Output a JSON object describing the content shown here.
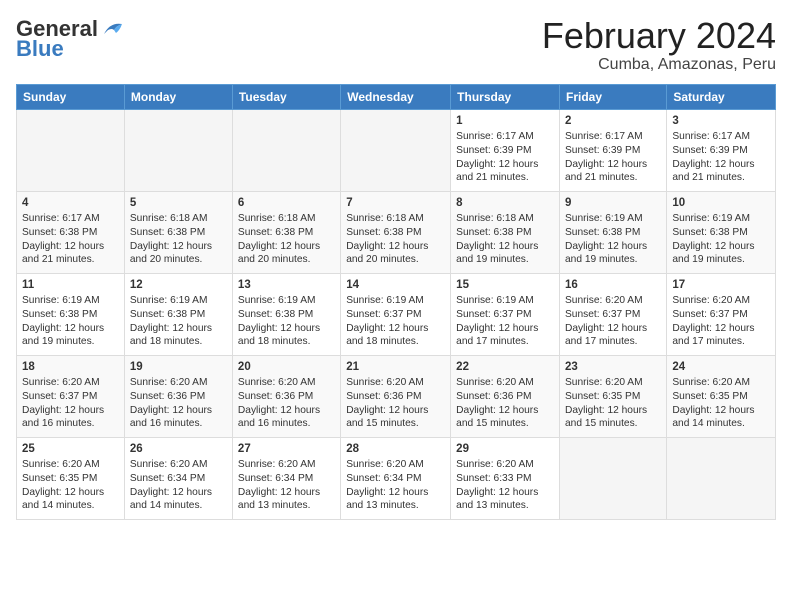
{
  "header": {
    "logo_general": "General",
    "logo_blue": "Blue",
    "title": "February 2024",
    "subtitle": "Cumba, Amazonas, Peru"
  },
  "days_of_week": [
    "Sunday",
    "Monday",
    "Tuesday",
    "Wednesday",
    "Thursday",
    "Friday",
    "Saturday"
  ],
  "weeks": [
    [
      {
        "day": "",
        "info": ""
      },
      {
        "day": "",
        "info": ""
      },
      {
        "day": "",
        "info": ""
      },
      {
        "day": "",
        "info": ""
      },
      {
        "day": "1",
        "info": "Sunrise: 6:17 AM\nSunset: 6:39 PM\nDaylight: 12 hours and 21 minutes."
      },
      {
        "day": "2",
        "info": "Sunrise: 6:17 AM\nSunset: 6:39 PM\nDaylight: 12 hours and 21 minutes."
      },
      {
        "day": "3",
        "info": "Sunrise: 6:17 AM\nSunset: 6:39 PM\nDaylight: 12 hours and 21 minutes."
      }
    ],
    [
      {
        "day": "4",
        "info": "Sunrise: 6:17 AM\nSunset: 6:38 PM\nDaylight: 12 hours and 21 minutes."
      },
      {
        "day": "5",
        "info": "Sunrise: 6:18 AM\nSunset: 6:38 PM\nDaylight: 12 hours and 20 minutes."
      },
      {
        "day": "6",
        "info": "Sunrise: 6:18 AM\nSunset: 6:38 PM\nDaylight: 12 hours and 20 minutes."
      },
      {
        "day": "7",
        "info": "Sunrise: 6:18 AM\nSunset: 6:38 PM\nDaylight: 12 hours and 20 minutes."
      },
      {
        "day": "8",
        "info": "Sunrise: 6:18 AM\nSunset: 6:38 PM\nDaylight: 12 hours and 19 minutes."
      },
      {
        "day": "9",
        "info": "Sunrise: 6:19 AM\nSunset: 6:38 PM\nDaylight: 12 hours and 19 minutes."
      },
      {
        "day": "10",
        "info": "Sunrise: 6:19 AM\nSunset: 6:38 PM\nDaylight: 12 hours and 19 minutes."
      }
    ],
    [
      {
        "day": "11",
        "info": "Sunrise: 6:19 AM\nSunset: 6:38 PM\nDaylight: 12 hours and 19 minutes."
      },
      {
        "day": "12",
        "info": "Sunrise: 6:19 AM\nSunset: 6:38 PM\nDaylight: 12 hours and 18 minutes."
      },
      {
        "day": "13",
        "info": "Sunrise: 6:19 AM\nSunset: 6:38 PM\nDaylight: 12 hours and 18 minutes."
      },
      {
        "day": "14",
        "info": "Sunrise: 6:19 AM\nSunset: 6:37 PM\nDaylight: 12 hours and 18 minutes."
      },
      {
        "day": "15",
        "info": "Sunrise: 6:19 AM\nSunset: 6:37 PM\nDaylight: 12 hours and 17 minutes."
      },
      {
        "day": "16",
        "info": "Sunrise: 6:20 AM\nSunset: 6:37 PM\nDaylight: 12 hours and 17 minutes."
      },
      {
        "day": "17",
        "info": "Sunrise: 6:20 AM\nSunset: 6:37 PM\nDaylight: 12 hours and 17 minutes."
      }
    ],
    [
      {
        "day": "18",
        "info": "Sunrise: 6:20 AM\nSunset: 6:37 PM\nDaylight: 12 hours and 16 minutes."
      },
      {
        "day": "19",
        "info": "Sunrise: 6:20 AM\nSunset: 6:36 PM\nDaylight: 12 hours and 16 minutes."
      },
      {
        "day": "20",
        "info": "Sunrise: 6:20 AM\nSunset: 6:36 PM\nDaylight: 12 hours and 16 minutes."
      },
      {
        "day": "21",
        "info": "Sunrise: 6:20 AM\nSunset: 6:36 PM\nDaylight: 12 hours and 15 minutes."
      },
      {
        "day": "22",
        "info": "Sunrise: 6:20 AM\nSunset: 6:36 PM\nDaylight: 12 hours and 15 minutes."
      },
      {
        "day": "23",
        "info": "Sunrise: 6:20 AM\nSunset: 6:35 PM\nDaylight: 12 hours and 15 minutes."
      },
      {
        "day": "24",
        "info": "Sunrise: 6:20 AM\nSunset: 6:35 PM\nDaylight: 12 hours and 14 minutes."
      }
    ],
    [
      {
        "day": "25",
        "info": "Sunrise: 6:20 AM\nSunset: 6:35 PM\nDaylight: 12 hours and 14 minutes."
      },
      {
        "day": "26",
        "info": "Sunrise: 6:20 AM\nSunset: 6:34 PM\nDaylight: 12 hours and 14 minutes."
      },
      {
        "day": "27",
        "info": "Sunrise: 6:20 AM\nSunset: 6:34 PM\nDaylight: 12 hours and 13 minutes."
      },
      {
        "day": "28",
        "info": "Sunrise: 6:20 AM\nSunset: 6:34 PM\nDaylight: 12 hours and 13 minutes."
      },
      {
        "day": "29",
        "info": "Sunrise: 6:20 AM\nSunset: 6:33 PM\nDaylight: 12 hours and 13 minutes."
      },
      {
        "day": "",
        "info": ""
      },
      {
        "day": "",
        "info": ""
      }
    ]
  ]
}
